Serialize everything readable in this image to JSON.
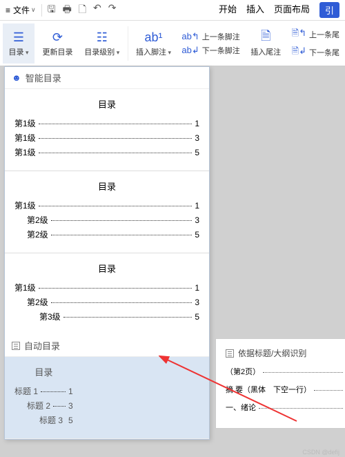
{
  "menubar": {
    "file": "文件",
    "tabs": {
      "start": "开始",
      "insert": "插入",
      "layout": "页面布局",
      "reference": "引"
    }
  },
  "ribbon": {
    "toc": "目录",
    "update": "更新目录",
    "level": "目录级别",
    "footnote": "插入脚注",
    "prev_fn": "上一条脚注",
    "next_fn": "下一条脚注",
    "endnote": "插入尾注",
    "prev_en": "上一条尾",
    "next_en": "下一条尾"
  },
  "dropdown": {
    "smart_header": "智能目录",
    "auto_header": "自动目录",
    "previews": [
      {
        "title": "目录",
        "lines": [
          {
            "indent": 0,
            "name": "第1级",
            "page": "1"
          },
          {
            "indent": 0,
            "name": "第1级",
            "page": "3"
          },
          {
            "indent": 0,
            "name": "第1级",
            "page": "5"
          }
        ]
      },
      {
        "title": "目录",
        "lines": [
          {
            "indent": 0,
            "name": "第1级",
            "page": "1"
          },
          {
            "indent": 1,
            "name": "第2级",
            "page": "3"
          },
          {
            "indent": 1,
            "name": "第2级",
            "page": "5"
          }
        ]
      },
      {
        "title": "目录",
        "lines": [
          {
            "indent": 0,
            "name": "第1级",
            "page": "1"
          },
          {
            "indent": 1,
            "name": "第2级",
            "page": "3"
          },
          {
            "indent": 2,
            "name": "第3级",
            "page": "5"
          }
        ]
      }
    ],
    "auto_preview": {
      "title": "目录",
      "lines": [
        {
          "indent": 0,
          "name": "标题 1",
          "page": "1"
        },
        {
          "indent": 1,
          "name": "标题 2",
          "page": "3"
        },
        {
          "indent": 2,
          "name": "标题 3",
          "page": "5"
        }
      ]
    }
  },
  "page": {
    "head": "依据标题/大纲识别",
    "line1": "（第2页）",
    "line2": "摘 要（黑体　下空一行）",
    "line3": "一、绪论"
  },
  "watermark": "CSDN @defij"
}
